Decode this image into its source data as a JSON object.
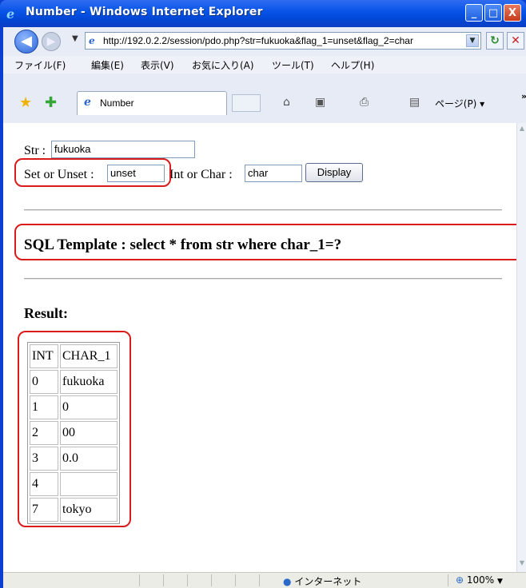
{
  "window": {
    "title": "Number - Windows Internet Explorer",
    "minimize": "_",
    "maximize": "□",
    "close": "X"
  },
  "address": {
    "url": "http://192.0.2.2/session/pdo.php?str=fukuoka&flag_1=unset&flag_2=char"
  },
  "menu": [
    "ファイル(F)",
    "編集(E)",
    "表示(V)",
    "お気に入り(A)",
    "ツール(T)",
    "ヘルプ(H)"
  ],
  "tab": {
    "label": "Number"
  },
  "toolbar": {
    "page_label": "ページ(P) ▾",
    "more": "»"
  },
  "form": {
    "str_label": "Str :",
    "str_value": "fukuoka",
    "flag_label": "Set or Unset :",
    "flag_value": "unset",
    "type_label": "Int or Char :",
    "type_value": "char",
    "display_button": "Display"
  },
  "sql": {
    "template": "SQL Template : select * from str where char_1=?"
  },
  "result": {
    "heading": "Result:",
    "columns": [
      "INT",
      "CHAR_1"
    ],
    "rows": [
      [
        "0",
        "fukuoka"
      ],
      [
        "1",
        "0"
      ],
      [
        "2",
        "00"
      ],
      [
        "3",
        "0.0"
      ],
      [
        "4",
        ""
      ],
      [
        "7",
        "tokyo"
      ]
    ]
  },
  "status": {
    "zone": "インターネット",
    "zoom": "100%"
  },
  "colors": {
    "highlight": "#d91b1b",
    "titlebar": "#0a55e8"
  }
}
